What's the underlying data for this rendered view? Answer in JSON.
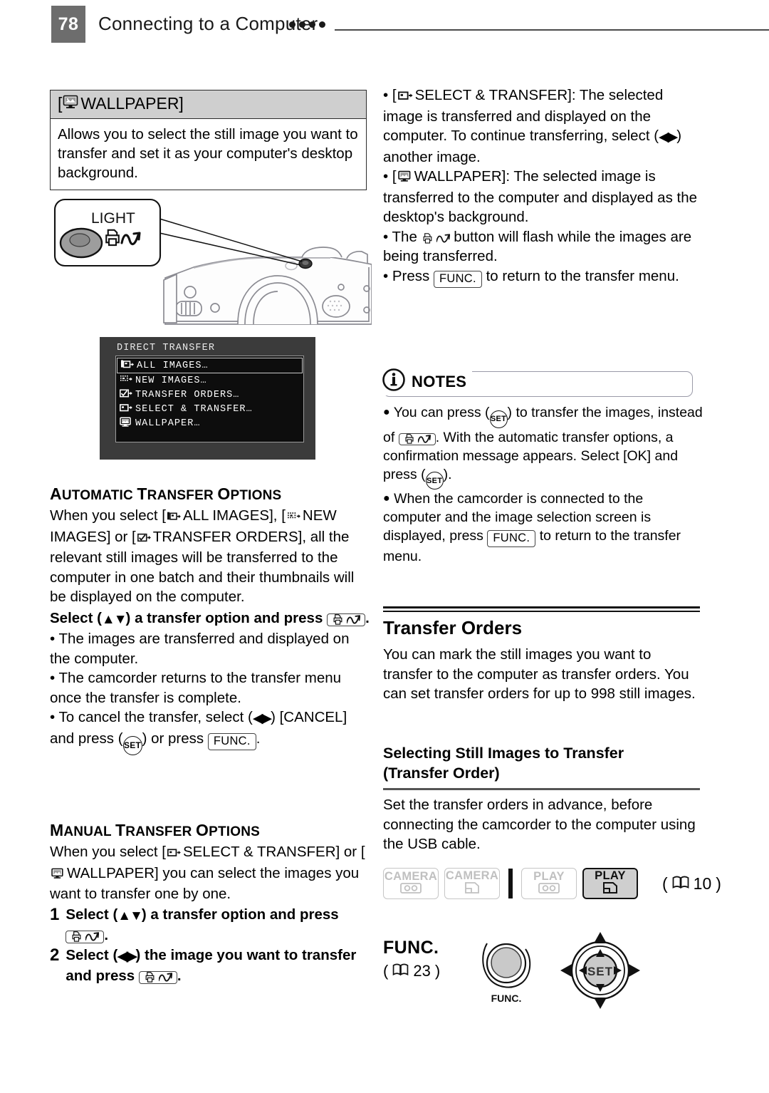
{
  "header": {
    "page_number": "78",
    "chapter_title": "Connecting to a Computer",
    "dot_count": 4
  },
  "wallpaper_box": {
    "title": "WALLPAPER]",
    "title_prefix": "[",
    "icon": "monitor-picture-icon",
    "body": "Allows you to select the still image you want to transfer and set it as your computer's desktop background."
  },
  "camera_illustration": {
    "callout_label": "LIGHT",
    "callout_icon": "direct-transfer-print-icon",
    "alt": "camcorder side view with LIGHT / print-share button callout"
  },
  "osd_menu": {
    "title": "DIRECT TRANSFER",
    "items": [
      {
        "icon": "all-images-icon",
        "label": "ALL IMAGES…",
        "selected": true
      },
      {
        "icon": "new-images-icon",
        "label": "NEW IMAGES…",
        "selected": false
      },
      {
        "icon": "transfer-orders-icon",
        "label": "TRANSFER ORDERS…",
        "selected": false
      },
      {
        "icon": "select-transfer-icon",
        "label": "SELECT & TRANSFER…",
        "selected": false
      },
      {
        "icon": "wallpaper-icon",
        "label": "WALLPAPER…",
        "selected": false
      }
    ]
  },
  "automatic_section": {
    "heading": "Automatic transfer options",
    "paragraph_1": "When you select [",
    "opt1": "ALL IMAGES],",
    "paragraph_2": "[",
    "opt2": "NEW IMAGES] or [",
    "opt3": "TRANSFER ORDERS], all the relevant still images will be transferred to the computer in one batch and their thumbnails will be displayed on the computer.",
    "bold_step_a": "Select (",
    "bold_step_b": ") a transfer option and press",
    "bold_step_c": ".",
    "bullets": [
      "The images are transferred and displayed on the computer.",
      "The camcorder returns to the transfer menu once the transfer is complete."
    ],
    "cancel_a": "To cancel the transfer, select (",
    "cancel_b": ") [CANCEL] and press (",
    "cancel_c": ") or press",
    "cancel_d": "."
  },
  "manual_section": {
    "heading": "Manual transfer options",
    "intro_a": "When you select [",
    "intro_b": "SELECT & TRANSFER] or [",
    "intro_c": "WALLPAPER] you can select the images you want to transfer one by one.",
    "steps": [
      {
        "num": "1",
        "a": "Select (",
        "arrows": "updown",
        "b": ") a transfer option and press",
        "c": "."
      },
      {
        "num": "2",
        "a": "Select (",
        "arrows": "leftright",
        "b": ") the image you want to transfer and press",
        "c": "."
      }
    ]
  },
  "right_bullets": {
    "b1_a": "[",
    "b1_b": "SELECT & TRANSFER]: The selected image is transferred and displayed on the computer. To continue transferring, select (",
    "b1_c": ") another image.",
    "b2_a": "[",
    "b2_b": "WALLPAPER]: The selected image is transferred to the computer and displayed as the desktop's background.",
    "b3_a": "The",
    "b3_b": "button will flash while the images are being transferred.",
    "b4_a": "Press",
    "b4_b": "to return to the transfer menu."
  },
  "notes": {
    "label": "NOTES",
    "icon": "info-circle-icon",
    "n1_a": "You can press (",
    "n1_b": ") to transfer the images, instead of",
    "n1_c": ". With the automatic transfer options, a confirmation message appears. Select [OK] and press (",
    "n1_d": ").",
    "n2_a": "When the camcorder is connected to the computer and the image selection screen is displayed, press",
    "n2_b": "to return to the transfer menu."
  },
  "transfer_orders": {
    "title": "Transfer Orders",
    "body": "You can mark the still images you want to transfer to the computer as transfer orders. You can set transfer orders for up to 998 still images.",
    "sub_title_line1": "Selecting Still Images to Transfer",
    "sub_title_line2": "(Transfer Order)",
    "sub_body": "Set the transfer orders in advance, before connecting the camcorder to the computer using the USB cable."
  },
  "mode_badges": {
    "items": [
      {
        "label": "CAMERA",
        "media": "tape",
        "active": false
      },
      {
        "label": "CAMERA",
        "media": "card",
        "active": false
      },
      {
        "label": "PLAY",
        "media": "tape",
        "active": false
      },
      {
        "label": "PLAY",
        "media": "card",
        "active": true
      }
    ],
    "page_ref": "10",
    "page_icon": "book-icon"
  },
  "func_row": {
    "label": "FUNC.",
    "page_ref": "23",
    "page_icon": "book-icon",
    "dial_label": "FUNC.",
    "joystick_label": "SET"
  }
}
